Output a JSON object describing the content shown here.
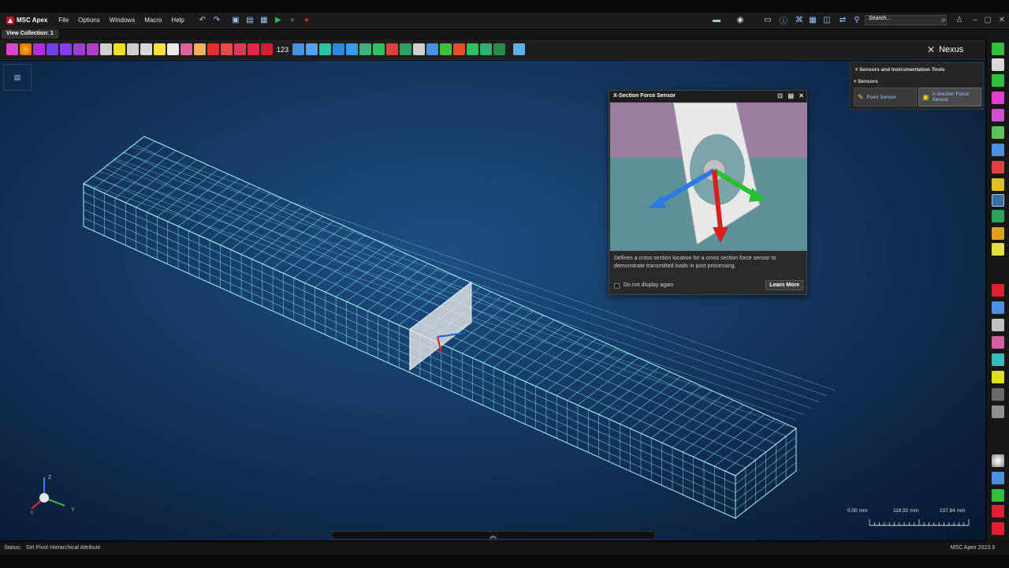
{
  "app": {
    "title": "MSC Apex",
    "menu": [
      "File",
      "Options",
      "Windows",
      "Macro",
      "Help"
    ],
    "search_placeholder": "Search...",
    "view_tab": "View Collection: 1",
    "toolbar_number": "123",
    "nexus_label": "Nexus"
  },
  "popup": {
    "title": "X-Section Force Sensor",
    "description": "Defines a cross section location for a cross section force sensor to demonstrate transmitted loads in post processing.",
    "checkbox_label": "Do not display again",
    "learn_more": "Learn More"
  },
  "panel": {
    "header": "Sensors and Instrumentation Tools",
    "section": "Sensors",
    "point_sensor": "Point Sensor",
    "xsection_sensor_line1": "X-Section Force",
    "xsection_sensor_line2": "Sensor"
  },
  "triad": {
    "z": "Z",
    "x": "X",
    "y": "Y"
  },
  "scale": {
    "labels": [
      "0,00 mm",
      "118,92 mm",
      "237,84 mm"
    ]
  },
  "status": {
    "label": "Status:",
    "text": "Set Pivot Hierarchical Attribute",
    "version": "MSC Apex 2023.3"
  }
}
